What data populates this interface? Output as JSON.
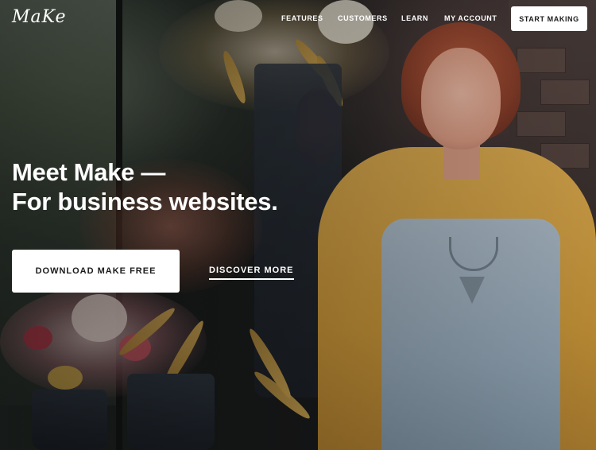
{
  "nav": {
    "logo": "MaKe",
    "links": [
      "FEATURES",
      "CUSTOMERS",
      "LEARN",
      "MY ACCOUNT"
    ],
    "cta": "START MAKING"
  },
  "hero": {
    "headline_line1": "Meet Make —",
    "headline_line2": "For business websites.",
    "primary_button": "DOWNLOAD MAKE FREE",
    "secondary_link": "DISCOVER MORE"
  },
  "colors": {
    "text": "#ffffff",
    "button_bg": "#ffffff",
    "button_text": "#1b1b1b"
  },
  "icons": {
    "logo": "make-logo-script"
  }
}
